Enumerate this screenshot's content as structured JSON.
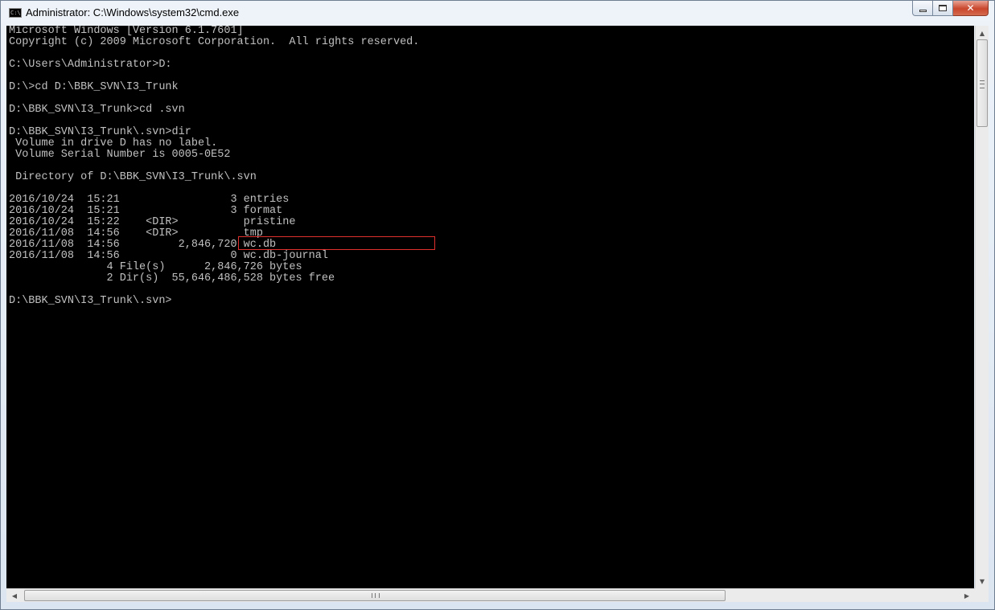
{
  "window": {
    "title": "Administrator: C:\\Windows\\system32\\cmd.exe",
    "app_icon_text": "C:\\",
    "close_glyph": "✕"
  },
  "console": {
    "lines": [
      "Microsoft Windows [Version 6.1.7601]",
      "Copyright (c) 2009 Microsoft Corporation.  All rights reserved.",
      "",
      "C:\\Users\\Administrator>D:",
      "",
      "D:\\>cd D:\\BBK_SVN\\I3_Trunk",
      "",
      "D:\\BBK_SVN\\I3_Trunk>cd .svn",
      "",
      "D:\\BBK_SVN\\I3_Trunk\\.svn>dir",
      " Volume in drive D has no label.",
      " Volume Serial Number is 0005-0E52",
      "",
      " Directory of D:\\BBK_SVN\\I3_Trunk\\.svn",
      "",
      "2016/10/24  15:21                 3 entries",
      "2016/10/24  15:21                 3 format",
      "2016/10/24  15:22    <DIR>          pristine",
      "2016/11/08  14:56    <DIR>          tmp",
      "2016/11/08  14:56         2,846,720 wc.db",
      "2016/11/08  14:56                 0 wc.db-journal",
      "               4 File(s)      2,846,726 bytes",
      "               2 Dir(s)  55,646,486,528 bytes free",
      "",
      "D:\\BBK_SVN\\I3_Trunk\\.svn>"
    ],
    "text_color": "#c0c0c0",
    "background": "#000000",
    "highlight_color": "#e0302e"
  },
  "scrollbars": {
    "up_arrow": "▲",
    "down_arrow": "▼",
    "left_arrow": "◀",
    "right_arrow": "▶"
  }
}
